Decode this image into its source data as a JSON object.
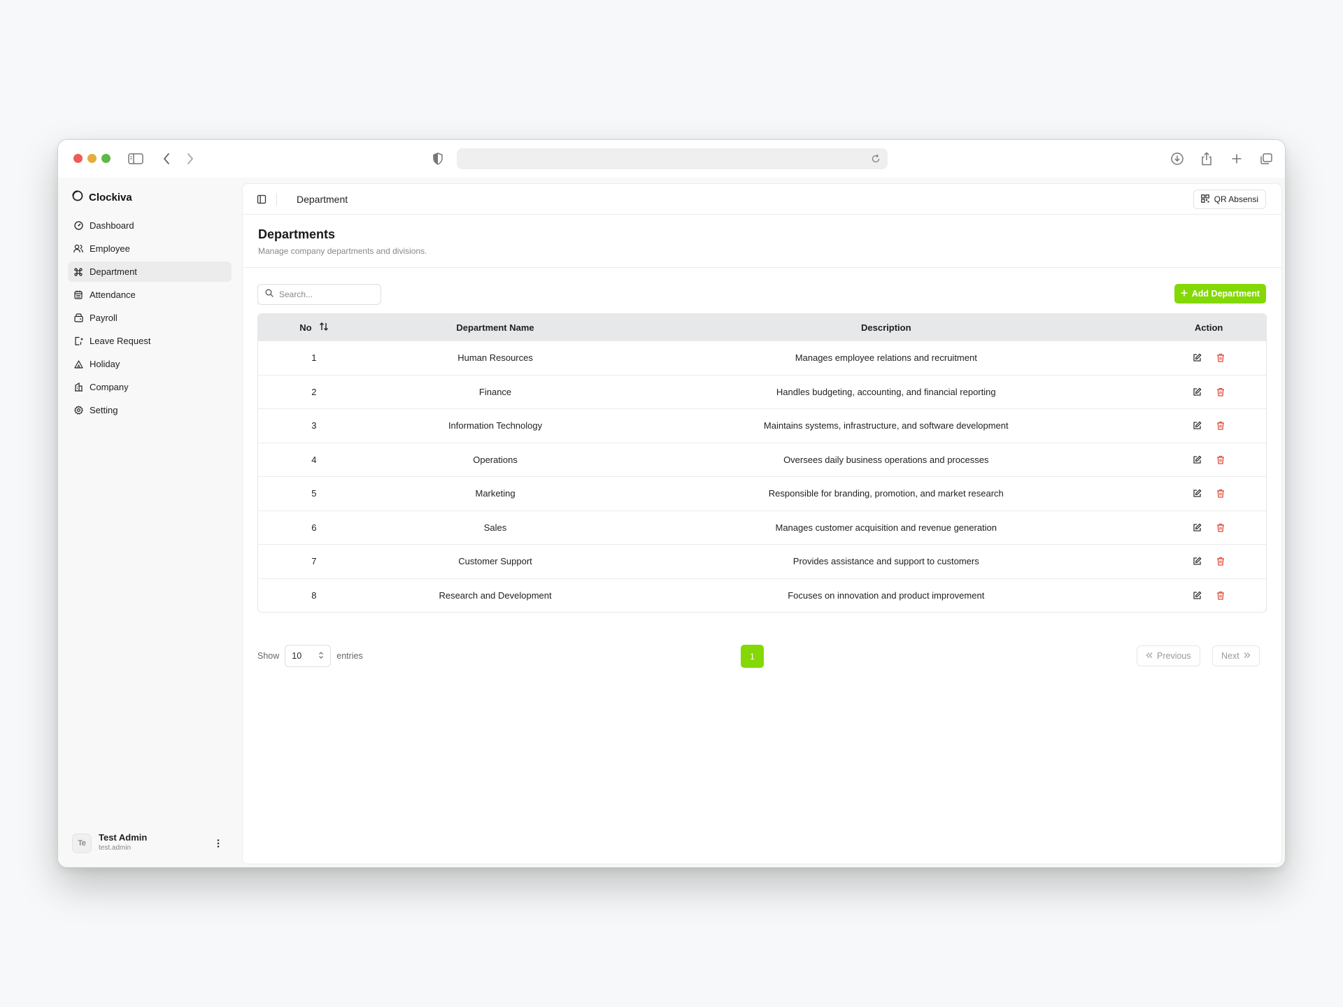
{
  "browser": {
    "url": ""
  },
  "sidebar": {
    "brand": "Clockiva",
    "items": [
      {
        "label": "Dashboard",
        "icon": "gauge-icon"
      },
      {
        "label": "Employee",
        "icon": "users-icon"
      },
      {
        "label": "Department",
        "icon": "command-icon",
        "active": true
      },
      {
        "label": "Attendance",
        "icon": "calendar-icon"
      },
      {
        "label": "Payroll",
        "icon": "wallet-icon"
      },
      {
        "label": "Leave Request",
        "icon": "door-icon"
      },
      {
        "label": "Holiday",
        "icon": "tent-icon"
      },
      {
        "label": "Company",
        "icon": "building-icon"
      },
      {
        "label": "Setting",
        "icon": "gear-icon"
      }
    ],
    "user": {
      "initials": "Te",
      "name": "Test Admin",
      "handle": "test.admin"
    }
  },
  "header": {
    "breadcrumb": "Department",
    "qr_button": "QR Absensi"
  },
  "page": {
    "title": "Departments",
    "subtitle": "Manage company departments and divisions."
  },
  "toolbar": {
    "search_placeholder": "Search...",
    "add_button": "Add Department"
  },
  "table": {
    "columns": {
      "no": "No",
      "name": "Department Name",
      "description": "Description",
      "action": "Action"
    },
    "rows": [
      {
        "no": "1",
        "name": "Human Resources",
        "description": "Manages employee relations and recruitment"
      },
      {
        "no": "2",
        "name": "Finance",
        "description": "Handles budgeting, accounting, and financial reporting"
      },
      {
        "no": "3",
        "name": "Information Technology",
        "description": "Maintains systems, infrastructure, and software development"
      },
      {
        "no": "4",
        "name": "Operations",
        "description": "Oversees daily business operations and processes"
      },
      {
        "no": "5",
        "name": "Marketing",
        "description": "Responsible for branding, promotion, and market research"
      },
      {
        "no": "6",
        "name": "Sales",
        "description": "Manages customer acquisition and revenue generation"
      },
      {
        "no": "7",
        "name": "Customer Support",
        "description": "Provides assistance and support to customers"
      },
      {
        "no": "8",
        "name": "Research and Development",
        "description": "Focuses on innovation and product improvement"
      }
    ]
  },
  "pagination": {
    "show_label": "Show",
    "page_size": "10",
    "entries_label": "entries",
    "current_page": "1",
    "previous": "Previous",
    "next": "Next"
  },
  "colors": {
    "accent": "#84d806",
    "delete": "#e24b3b"
  }
}
